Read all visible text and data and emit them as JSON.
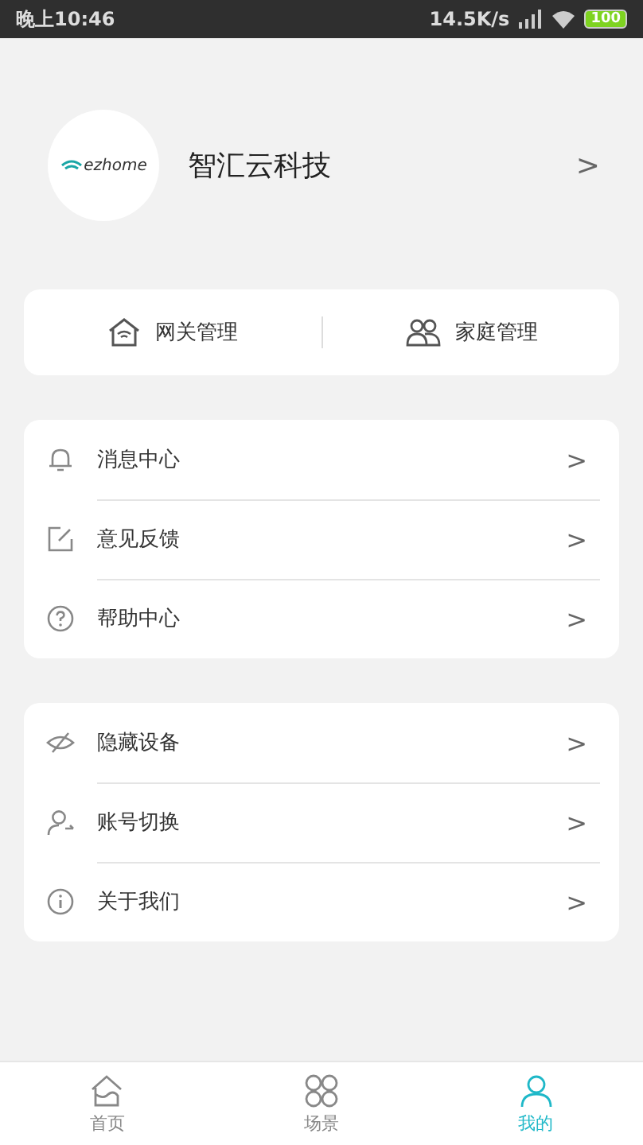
{
  "status_bar": {
    "time": "晚上10:46",
    "speed": "14.5K/s",
    "battery": "100"
  },
  "profile": {
    "logo_text": "ezhome",
    "name": "智汇云科技",
    "arrow": ">"
  },
  "quick_actions": [
    {
      "kind": "gateway",
      "label": "网关管理"
    },
    {
      "kind": "family",
      "label": "家庭管理"
    }
  ],
  "menu_groups": [
    [
      {
        "kind": "bell",
        "label": "消息中心",
        "arrow": ">"
      },
      {
        "kind": "edit",
        "label": "意见反馈",
        "arrow": ">"
      },
      {
        "kind": "help",
        "label": "帮助中心",
        "arrow": ">"
      }
    ],
    [
      {
        "kind": "hide",
        "label": "隐藏设备",
        "arrow": ">"
      },
      {
        "kind": "account",
        "label": "账号切换",
        "arrow": ">"
      },
      {
        "kind": "info",
        "label": "关于我们",
        "arrow": ">"
      }
    ]
  ],
  "tabs": [
    {
      "kind": "home",
      "label": "首页",
      "selected": false
    },
    {
      "kind": "scene",
      "label": "场景",
      "selected": false
    },
    {
      "kind": "me",
      "label": "我的",
      "selected": true
    }
  ]
}
